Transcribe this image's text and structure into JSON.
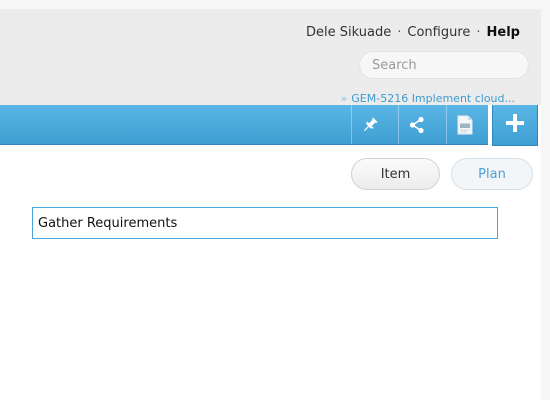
{
  "header": {
    "user_name": "Dele Sikuade",
    "separator": "·",
    "configure_label": "Configure",
    "help_label": "Help",
    "search": {
      "placeholder": "Search"
    },
    "breadcrumb": {
      "chevron": "»",
      "link": "GEM-5216 Implement cloud..."
    }
  },
  "toolbar": {
    "icons": [
      "pin-icon",
      "share-icon",
      "pdf-icon",
      "plus-icon"
    ],
    "accent_color": "#4aa9dc"
  },
  "mode_buttons": {
    "item_label": "Item",
    "plan_label": "Plan"
  },
  "form": {
    "name_value": "Gather Requirements "
  }
}
